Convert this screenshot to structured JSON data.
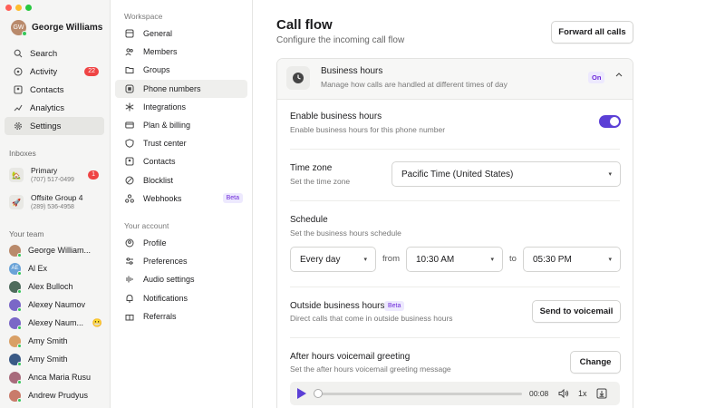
{
  "window": {
    "controls": [
      "close",
      "minimize",
      "zoom"
    ],
    "colors": {
      "close": "#ff5f57",
      "minimize": "#febc2e",
      "zoom": "#28c840"
    }
  },
  "user": {
    "name": "George Williams",
    "initials": "GW"
  },
  "nav": [
    {
      "label": "Search",
      "icon": "search-icon"
    },
    {
      "label": "Activity",
      "icon": "activity-icon",
      "badge": "22"
    },
    {
      "label": "Contacts",
      "icon": "contacts-icon"
    },
    {
      "label": "Analytics",
      "icon": "analytics-icon"
    },
    {
      "label": "Settings",
      "icon": "gear-icon",
      "active": true
    }
  ],
  "inboxes": {
    "label": "Inboxes",
    "items": [
      {
        "name": "Primary",
        "phone": "(707) 517-0499",
        "badge": "1",
        "emoji": "🏡"
      },
      {
        "name": "Offsite Group 4",
        "phone": "(289) 536-4958",
        "emoji": "🚀"
      }
    ]
  },
  "team": {
    "label": "Your team",
    "members": [
      {
        "name": "George William...",
        "initials": "GW",
        "color": "#b98a6b"
      },
      {
        "name": "Al Ex",
        "initials": "AE",
        "color": "#6aa3d8"
      },
      {
        "name": "Alex Bulloch",
        "initials": "AB",
        "color": "#4e6b5c"
      },
      {
        "name": "Alexey Naumov",
        "initials": "AN",
        "color": "#7a67c7"
      },
      {
        "name": "Alexey Naum...",
        "initials": "AN",
        "color": "#7a67c7",
        "emoji": "😬"
      },
      {
        "name": "Amy Smith",
        "initials": "AS",
        "color": "#d9a066"
      },
      {
        "name": "Amy Smith",
        "initials": "AS",
        "color": "#3a5a86"
      },
      {
        "name": "Anca Maria Rusu",
        "initials": "AR",
        "color": "#a86b7c"
      },
      {
        "name": "Andrew Prudyus",
        "initials": "AP",
        "color": "#c97b6a"
      }
    ]
  },
  "settings_nav": {
    "workspace_label": "Workspace",
    "workspace": [
      {
        "label": "General",
        "icon": "general-icon"
      },
      {
        "label": "Members",
        "icon": "members-icon"
      },
      {
        "label": "Groups",
        "icon": "folder-icon"
      },
      {
        "label": "Phone numbers",
        "icon": "phone-number-icon",
        "active": true
      },
      {
        "label": "Integrations",
        "icon": "integrations-icon"
      },
      {
        "label": "Plan & billing",
        "icon": "billing-icon"
      },
      {
        "label": "Trust center",
        "icon": "shield-icon"
      },
      {
        "label": "Contacts",
        "icon": "contacts-icon"
      },
      {
        "label": "Blocklist",
        "icon": "block-icon"
      },
      {
        "label": "Webhooks",
        "icon": "webhook-icon",
        "badge": "Beta"
      }
    ],
    "account_label": "Your account",
    "account": [
      {
        "label": "Profile",
        "icon": "profile-icon"
      },
      {
        "label": "Preferences",
        "icon": "sliders-icon"
      },
      {
        "label": "Audio settings",
        "icon": "audio-icon"
      },
      {
        "label": "Notifications",
        "icon": "bell-icon"
      },
      {
        "label": "Referrals",
        "icon": "gift-icon"
      }
    ]
  },
  "page": {
    "title": "Call flow",
    "subtitle": "Configure the incoming call flow",
    "forward_button": "Forward all calls"
  },
  "business_hours": {
    "title": "Business hours",
    "subtitle": "Manage how calls are handled at different times of day",
    "status": "On",
    "enable": {
      "title": "Enable business hours",
      "subtitle": "Enable business hours for this phone number",
      "on": true
    },
    "timezone": {
      "title": "Time zone",
      "subtitle": "Set the time zone",
      "value": "Pacific Time (United States)"
    },
    "schedule": {
      "title": "Schedule",
      "subtitle": "Set the business hours schedule",
      "days": "Every day",
      "from_word": "from",
      "from": "10:30 AM",
      "to_word": "to",
      "to": "05:30 PM"
    },
    "outside": {
      "title": "Outside business hours",
      "badge": "Beta",
      "subtitle": "Direct calls that come in outside business hours",
      "button": "Send to voicemail"
    },
    "greeting": {
      "title": "After hours voicemail greeting",
      "subtitle": "Set the after hours voicemail greeting message",
      "button": "Change",
      "player": {
        "time": "00:08",
        "speed": "1x",
        "progress": 0
      }
    }
  },
  "colors": {
    "accent": "#5b3fd6",
    "badge_red": "#ef4444",
    "beta_bg": "#ede9fe",
    "beta_text": "#6d28d9"
  }
}
